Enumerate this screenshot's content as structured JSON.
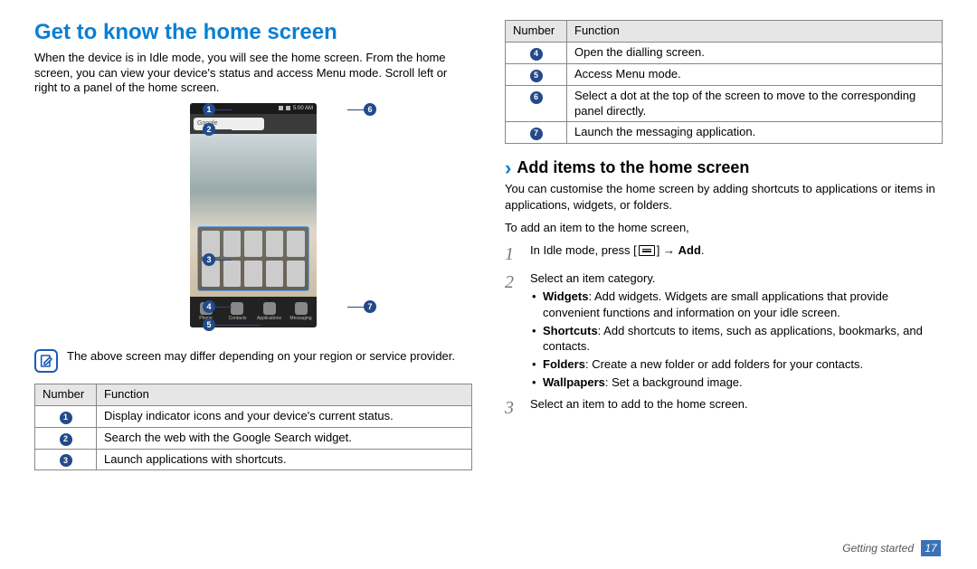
{
  "title": "Get to know the home screen",
  "intro": "When the device is in Idle mode, you will see the home screen. From the home screen, you can view your device's status and access Menu mode. Scroll left or right to a panel of the home screen.",
  "phone": {
    "time": "5:00 AM",
    "search_text": "Google",
    "dock": [
      "Phone",
      "Contacts",
      "Applications",
      "Messaging"
    ]
  },
  "callouts": {
    "c1": "1",
    "c2": "2",
    "c3": "3",
    "c4": "4",
    "c5": "5",
    "c6": "6",
    "c7": "7"
  },
  "note": "The above screen may differ depending on your region or service provider.",
  "table_headers": {
    "num": "Number",
    "func": "Function"
  },
  "table_left": [
    {
      "n": "1",
      "f": "Display indicator icons and your device's current status."
    },
    {
      "n": "2",
      "f": "Search the web with the Google Search widget."
    },
    {
      "n": "3",
      "f": "Launch applications with shortcuts."
    }
  ],
  "table_right": [
    {
      "n": "4",
      "f": "Open the dialling screen."
    },
    {
      "n": "5",
      "f": "Access Menu mode."
    },
    {
      "n": "6",
      "f": "Select a dot at the top of the screen to move to the corresponding panel directly."
    },
    {
      "n": "7",
      "f": "Launch the messaging application."
    }
  ],
  "sub_heading": "Add items to the home screen",
  "sub_intro": "You can customise the home screen by adding shortcuts to applications or items in applications, widgets, or folders.",
  "to_add": "To add an item to the home screen,",
  "steps": {
    "s1_pre": "In Idle mode, press [",
    "s1_post": "] → ",
    "s1_add": "Add",
    "s1_dot": ".",
    "s2": "Select an item category.",
    "s3": "Select an item to add to the home screen."
  },
  "options": {
    "widgets_b": "Widgets",
    "widgets": ": Add widgets. Widgets are small applications that provide convenient functions and information on your idle screen.",
    "shortcuts_b": "Shortcuts",
    "shortcuts": ": Add shortcuts to items, such as applications, bookmarks, and contacts.",
    "folders_b": "Folders",
    "folders": ": Create a new folder or add folders for your contacts.",
    "wallpapers_b": "Wallpapers",
    "wallpapers": ": Set a background image."
  },
  "footer": {
    "section": "Getting started",
    "page": "17"
  }
}
